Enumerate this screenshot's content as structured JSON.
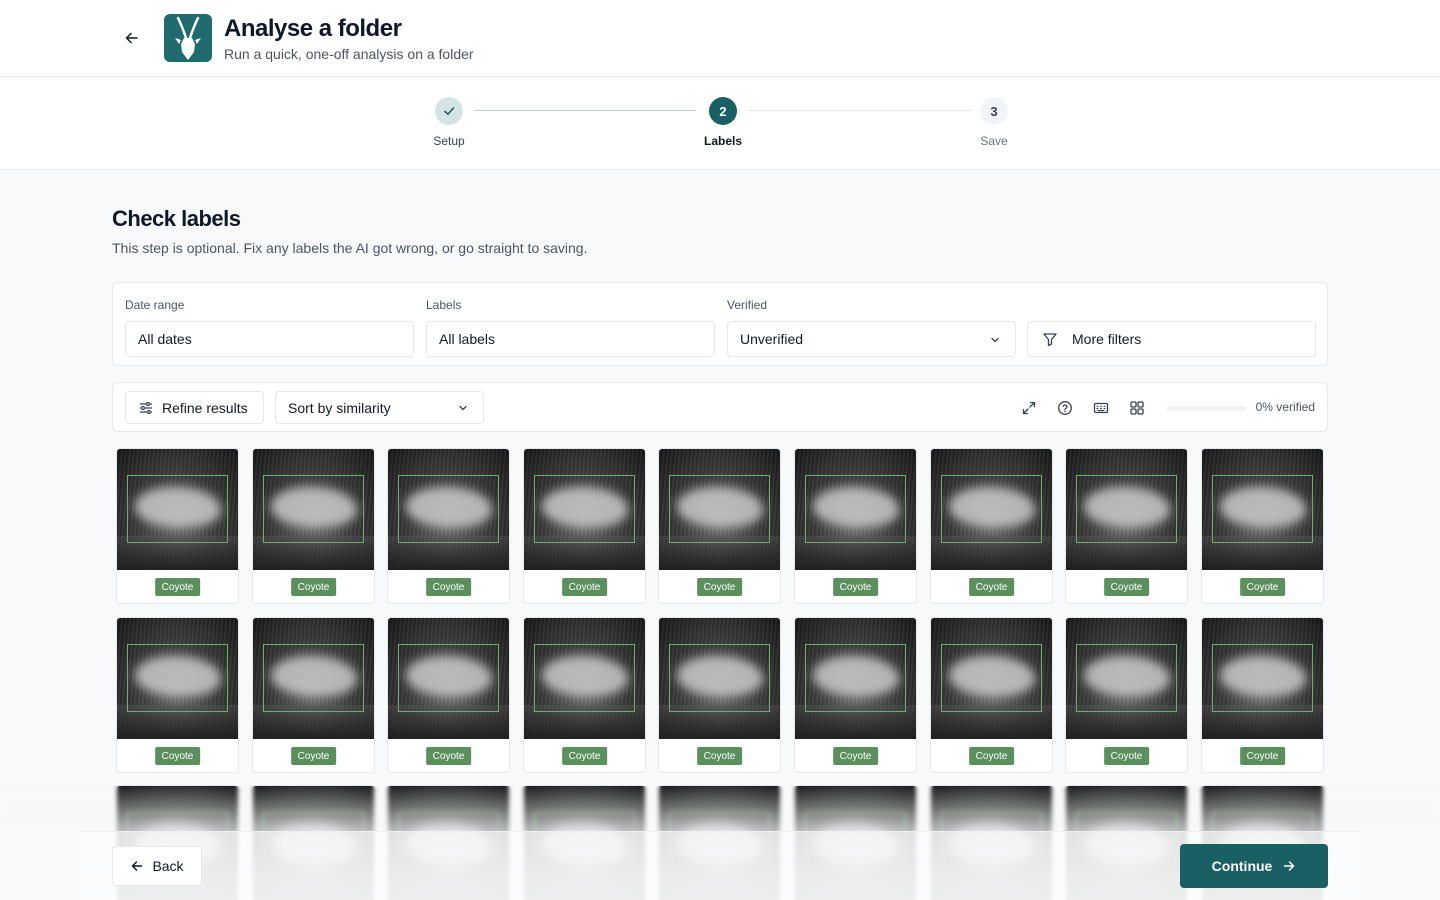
{
  "header": {
    "title": "Analyse a folder",
    "subtitle": "Run a quick, one-off analysis on a folder",
    "back_icon": "arrow-left-icon",
    "logo_icon": "antelope-logo-icon"
  },
  "stepper": {
    "steps": [
      {
        "marker": "✓",
        "label": "Setup",
        "state": "complete"
      },
      {
        "marker": "2",
        "label": "Labels",
        "state": "current"
      },
      {
        "marker": "3",
        "label": "Save",
        "state": "upcoming"
      }
    ]
  },
  "section": {
    "title": "Check labels",
    "description": "This step is optional. Fix any labels the AI got wrong, or go straight to saving."
  },
  "filters": {
    "date_range": {
      "label": "Date range",
      "value": "All dates"
    },
    "labels": {
      "label": "Labels",
      "value": "All labels"
    },
    "verified": {
      "label": "Verified",
      "value": "Unverified"
    },
    "more_filters": "More filters"
  },
  "toolbar": {
    "refine_label": "Refine results",
    "sort_value": "Sort by similarity",
    "icons": [
      "expand-icon",
      "help-icon",
      "keyboard-icon",
      "grid-icon"
    ],
    "progress_fraction": 0,
    "progress_text": "0% verified"
  },
  "images": {
    "rows": [
      [
        "Coyote",
        "Coyote",
        "Coyote",
        "Coyote",
        "Coyote",
        "Coyote",
        "Coyote",
        "Coyote",
        "Coyote"
      ],
      [
        "Coyote",
        "Coyote",
        "Coyote",
        "Coyote",
        "Coyote",
        "Coyote",
        "Coyote",
        "Coyote",
        "Coyote"
      ],
      [
        "",
        "",
        "",
        "",
        "",
        "",
        "",
        "",
        ""
      ]
    ]
  },
  "footer": {
    "back_label": "Back",
    "continue_label": "Continue"
  },
  "colors": {
    "brand": "#1a5f63",
    "tag_green": "#5b8f5d",
    "step_complete": "#d4e4e4"
  }
}
